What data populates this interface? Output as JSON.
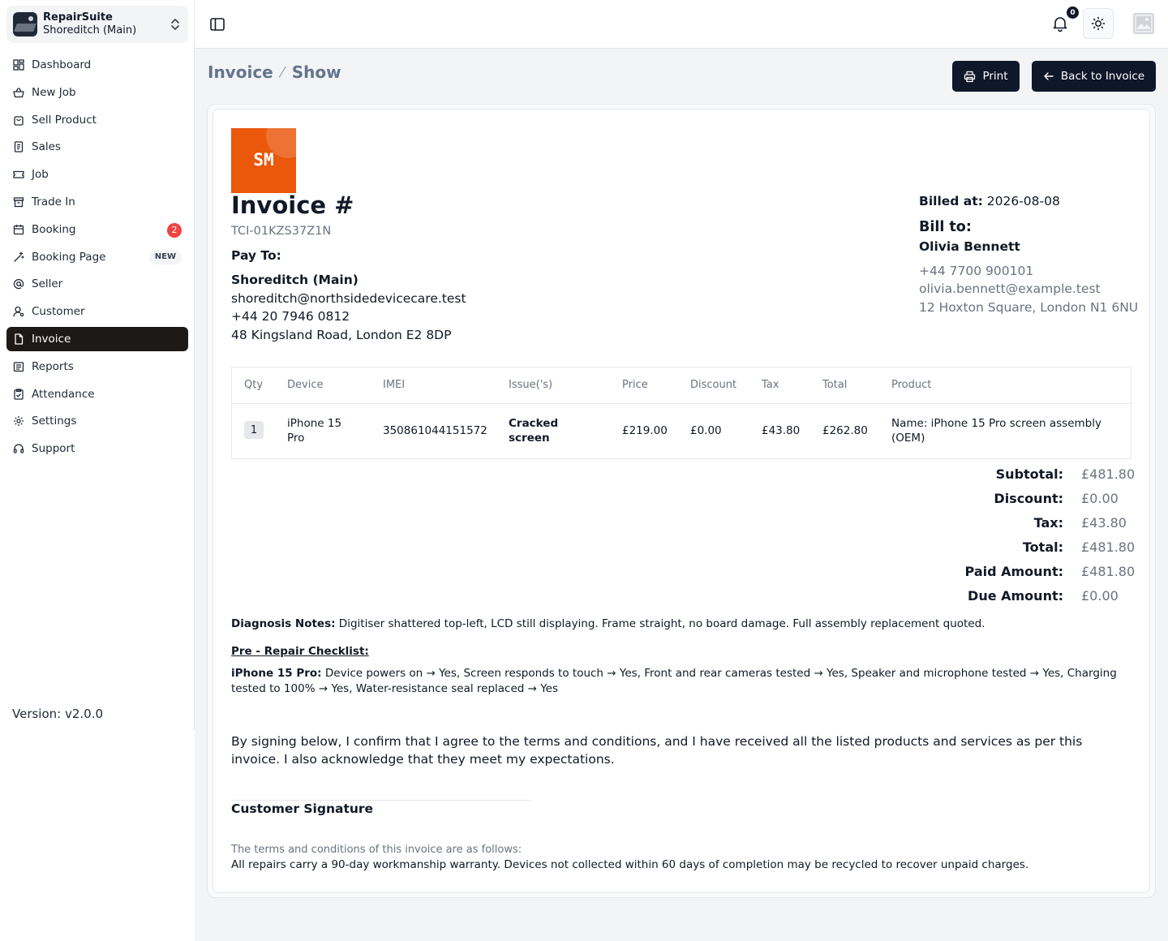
{
  "org": {
    "name": "RepairSuite",
    "branch": "Shoreditch (Main)"
  },
  "nav": [
    {
      "label": "Dashboard",
      "icon": "dashboard-icon"
    },
    {
      "label": "New Job",
      "icon": "basket-icon"
    },
    {
      "label": "Sell Product",
      "icon": "shopping-bag-icon"
    },
    {
      "label": "Sales",
      "icon": "receipt-icon"
    },
    {
      "label": "Job",
      "icon": "ticket-icon"
    },
    {
      "label": "Trade In",
      "icon": "archive-icon"
    },
    {
      "label": "Booking",
      "icon": "calendar-icon",
      "badge": "2"
    },
    {
      "label": "Booking Page",
      "icon": "magic-icon",
      "tag": "NEW"
    },
    {
      "label": "Seller",
      "icon": "at-sign-icon"
    },
    {
      "label": "Customer",
      "icon": "user-icon"
    },
    {
      "label": "Invoice",
      "icon": "file-icon",
      "active": true
    },
    {
      "label": "Reports",
      "icon": "list-icon"
    },
    {
      "label": "Attendance",
      "icon": "clipboard-icon"
    },
    {
      "label": "Settings",
      "icon": "gear-icon"
    },
    {
      "label": "Support",
      "icon": "headset-icon"
    }
  ],
  "version": "Version: v2.0.0",
  "topbar": {
    "notification_count": "0"
  },
  "breadcrumb": {
    "section": "Invoice",
    "separator": "⁄",
    "page": "Show"
  },
  "buttons": {
    "print": "Print",
    "back": "Back to Invoice"
  },
  "invoice": {
    "logo_text": "SM",
    "title": "Invoice #",
    "number": "TCI-01KZS37Z1N",
    "pay_to_label": "Pay To:",
    "pay_to_name": "Shoreditch (Main)",
    "pay_to_email": "shoreditch@northsidedevicecare.test",
    "pay_to_phone": "+44 20 7946 0812",
    "pay_to_address": "48 Kingsland Road, London E2 8DP",
    "billed_at_label": "Billed at:",
    "billed_at_value": "2026-08-08",
    "bill_to_label": "Bill to:",
    "bill_to_name": "Olivia Bennett",
    "bill_to_phone": "+44 7700 900101",
    "bill_to_email": "olivia.bennett@example.test",
    "bill_to_address": "12 Hoxton Square, London N1 6NU"
  },
  "table": {
    "headers": [
      "Qty",
      "Device",
      "IMEI",
      "Issue('s)",
      "Price",
      "Discount",
      "Tax",
      "Total",
      "Product"
    ],
    "rows": [
      {
        "qty": "1",
        "device_line1": "iPhone 15",
        "device_line2": "Pro",
        "imei": "350861044151572",
        "issue_line1": "Cracked",
        "issue_line2": "screen",
        "price": "£219.00",
        "discount": "£0.00",
        "tax": "£43.80",
        "total": "£262.80",
        "product_line1": "Name: iPhone 15 Pro screen assembly",
        "product_line2": "(OEM)"
      }
    ]
  },
  "totals": [
    {
      "label": "Subtotal:",
      "value": "£481.80"
    },
    {
      "label": "Discount:",
      "value": "£0.00"
    },
    {
      "label": "Tax:",
      "value": "£43.80"
    },
    {
      "label": "Total:",
      "value": "£481.80"
    },
    {
      "label": "Paid Amount:",
      "value": "£481.80"
    },
    {
      "label": "Due Amount:",
      "value": "£0.00"
    }
  ],
  "notes": {
    "diagnosis_label": "Diagnosis Notes:",
    "diagnosis_text": " Digitiser shattered top-left, LCD still displaying. Frame straight, no board damage. Full assembly replacement quoted.",
    "checklist_title": "Pre - Repair Checklist:",
    "checklist_device": "iPhone 15 Pro:",
    "checklist_text": " Device powers on → Yes, Screen responds to touch → Yes, Front and rear cameras tested → Yes, Speaker and microphone tested → Yes, Charging tested to 100% → Yes, Water-resistance seal replaced → Yes"
  },
  "consent": "By signing below, I confirm that I agree to the terms and conditions, and I have received all the listed products and services as per this invoice. I also acknowledge that they meet my expectations.",
  "signature_label": "Customer Signature",
  "terms": {
    "intro": "The terms and conditions of this invoice are as follows:",
    "body": "All repairs carry a 90-day workmanship warranty. Devices not collected within 60 days of completion may be recycled to recover unpaid charges."
  },
  "colors": {
    "accent": "#0f172a",
    "active_nav": "#1c1917",
    "logo": "#ea580c",
    "badge": "#ef4444"
  }
}
